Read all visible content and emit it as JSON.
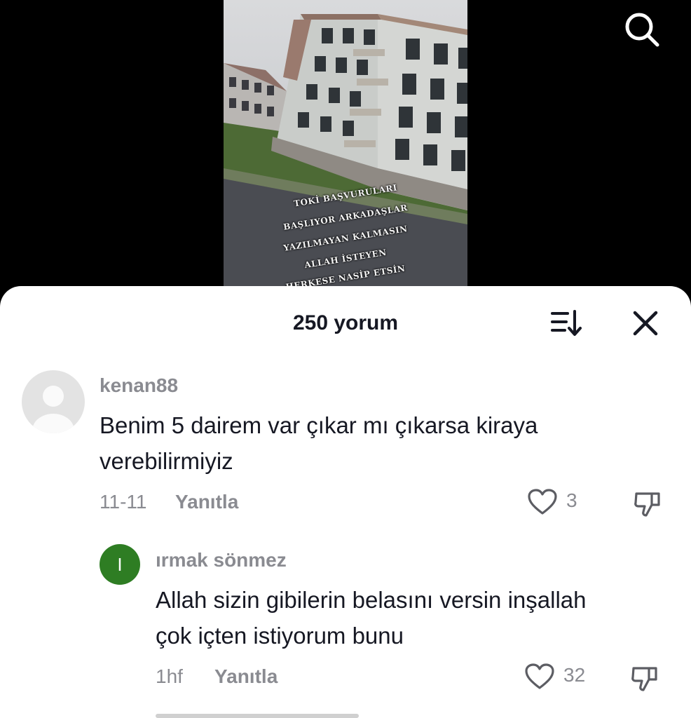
{
  "video": {
    "overlay_lines": [
      "TOKİ BAŞVURULARI",
      "BAŞLIYOR ARKADAŞLAR",
      "YAZILMAYAN KALMASIN",
      "ALLAH İSTEYEN",
      "HERKESE NASİP ETSİN"
    ],
    "search_icon": "search-icon"
  },
  "sheet": {
    "title": "250 yorum",
    "sort_icon": "sort-icon",
    "close_icon": "close-icon"
  },
  "comments": [
    {
      "avatar": "default-avatar",
      "username": "kenan88",
      "text_lines": [
        "Benim 5 dairem var çıkar mı çıkarsa kiraya",
        "verebilirmiyiz"
      ],
      "date": "11-11",
      "reply_label": "Yanıtla",
      "likes": "3"
    },
    {
      "avatar_letter": "I",
      "username": "ırmak sönmez",
      "text_lines": [
        "Allah sizin gibilerin belasını versin inşallah",
        "çok içten istiyorum bunu"
      ],
      "date": "1hf",
      "reply_label": "Yanıtla",
      "likes": "32"
    }
  ],
  "colors": {
    "background": "#000000",
    "sheet": "#ffffff",
    "text_primary": "#161823",
    "text_secondary": "#8a8b91",
    "avatar_green": "#2e7d23"
  }
}
